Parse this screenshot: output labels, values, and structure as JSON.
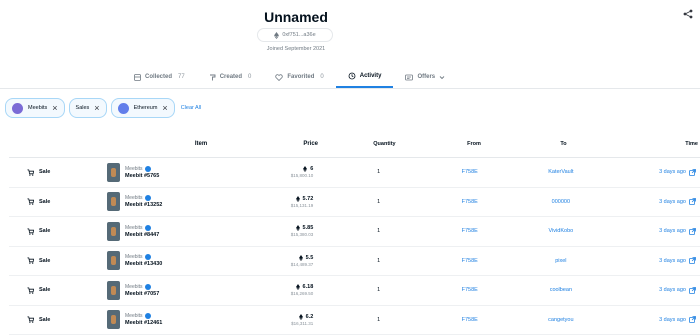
{
  "profile": {
    "username": "Unnamed",
    "address": "0xf751...a36e",
    "joined": "Joined September 2021"
  },
  "tabs": [
    {
      "label": "Collected",
      "count": "77",
      "icon": "grid-icon"
    },
    {
      "label": "Created",
      "count": "0",
      "icon": "brush-icon"
    },
    {
      "label": "Favorited",
      "count": "0",
      "icon": "heart-icon"
    },
    {
      "label": "Activity",
      "count": "",
      "icon": "history-icon"
    },
    {
      "label": "Offers",
      "count": "",
      "icon": "offers-icon"
    }
  ],
  "filters": {
    "chips": [
      {
        "label": "Meebits"
      },
      {
        "label": "Sales"
      },
      {
        "label": "Ethereum"
      }
    ],
    "clear_all": "Clear All"
  },
  "table": {
    "headers": {
      "item": "Item",
      "price": "Price",
      "quantity": "Quantity",
      "from": "From",
      "to": "To",
      "time": "Time"
    },
    "rows": [
      {
        "event": "Sale",
        "collection": "Meebits",
        "name": "Meebit #5765",
        "price": "6",
        "usd": "$15,800.10",
        "qty": "1",
        "from": "F758E",
        "to": "KaterVault",
        "time": "3 days ago"
      },
      {
        "event": "Sale",
        "collection": "Meebits",
        "name": "Meebit #13252",
        "price": "5.72",
        "usd": "$15,131.19",
        "qty": "1",
        "from": "F758E",
        "to": "000000",
        "time": "3 days ago"
      },
      {
        "event": "Sale",
        "collection": "Meebits",
        "name": "Meebit #8447",
        "price": "5.85",
        "usd": "$15,380.03",
        "qty": "1",
        "from": "F758E",
        "to": "VividKobo",
        "time": "3 days ago"
      },
      {
        "event": "Sale",
        "collection": "Meebits",
        "name": "Meebit #13430",
        "price": "5.5",
        "usd": "$14,489.37",
        "qty": "1",
        "from": "F758E",
        "to": "pixel",
        "time": "3 days ago"
      },
      {
        "event": "Sale",
        "collection": "Meebits",
        "name": "Meebit #7057",
        "price": "6.18",
        "usd": "$16,269.50",
        "qty": "1",
        "from": "F758E",
        "to": "coolbean",
        "time": "3 days ago"
      },
      {
        "event": "Sale",
        "collection": "Meebits",
        "name": "Meebit #12461",
        "price": "6.2",
        "usd": "$16,311.31",
        "qty": "1",
        "from": "F758E",
        "to": "cangetyou",
        "time": "3 days ago"
      }
    ]
  },
  "colors": {
    "accent": "#2081e2",
    "chip_border": "#a8d7f7",
    "text": "#04111d",
    "muted": "#707a83"
  }
}
